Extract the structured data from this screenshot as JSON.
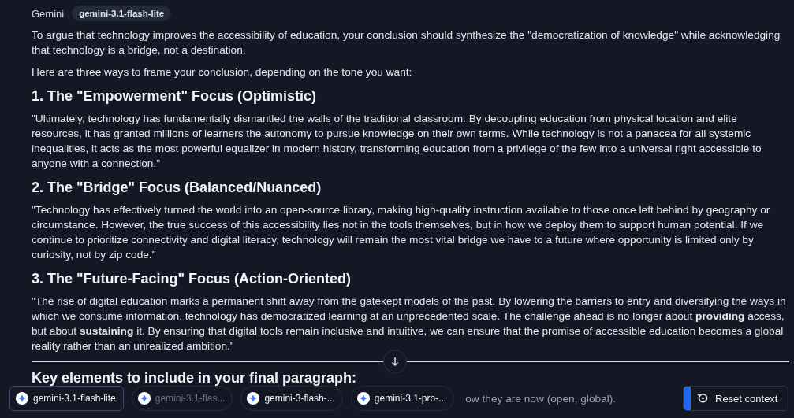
{
  "header": {
    "sender": "Gemini",
    "model_badge": "gemini-3.1-flash-lite"
  },
  "blocks": [
    {
      "kind": "paragraph",
      "text": "To argue that technology improves the accessibility of education, your conclusion should synthesize the \"democratization of knowledge\" while acknowledging that technology is a bridge, not a destination."
    },
    {
      "kind": "paragraph",
      "text": "Here are three ways to frame your conclusion, depending on the tone you want:"
    },
    {
      "kind": "heading",
      "text": "1. The \"Empowerment\" Focus (Optimistic)"
    },
    {
      "kind": "paragraph",
      "text": "\"Ultimately, technology has fundamentally dismantled the walls of the traditional classroom. By decoupling education from physical location and elite resources, it has granted millions of learners the autonomy to pursue knowledge on their own terms. While technology is not a panacea for all systemic inequalities, it acts as the most powerful equalizer in modern history, transforming education from a privilege of the few into a universal right accessible to anyone with a connection.\""
    },
    {
      "kind": "heading",
      "text": "2. The \"Bridge\" Focus (Balanced/Nuanced)"
    },
    {
      "kind": "paragraph",
      "text": "\"Technology has effectively turned the world into an open-source library, making high-quality instruction available to those once left behind by geography or circumstance. However, the true success of this accessibility lies not in the tools themselves, but in how we deploy them to support human potential. If we continue to prioritize connectivity and digital literacy, technology will remain the most vital bridge we have to a future where opportunity is limited only by curiosity, not by zip code.\""
    },
    {
      "kind": "heading",
      "text": "3. The \"Future-Facing\" Focus (Action-Oriented)"
    },
    {
      "kind": "paragraph",
      "text": "\"The rise of digital education marks a permanent shift away from the gatekept models of the past. By lowering the barriers to entry and diversifying the ways in which we consume information, technology has democratized learning at an unprecedented scale. The challenge ahead is no longer about **providing** access, but about **sustaining** it. By ensuring that digital tools remain inclusive and intuitive, we can ensure that the promise of accessible education becomes a global reality rather than an unrealized ambition.\""
    },
    {
      "kind": "heading",
      "text": "Key elements to include in your final paragraph:"
    }
  ],
  "covered_line": [
    "ow they are now (open, global)."
  ],
  "model_chips": [
    {
      "label": "gemini-3.1-flash-lite",
      "selected": true,
      "disabled": false
    },
    {
      "label": "gemini-3.1-flas...",
      "selected": false,
      "disabled": true
    },
    {
      "label": "gemini-3-flash-...",
      "selected": false,
      "disabled": false
    },
    {
      "label": "gemini-3.1-pro-...",
      "selected": false,
      "disabled": false
    }
  ],
  "reset_button": {
    "label": "Reset context"
  }
}
